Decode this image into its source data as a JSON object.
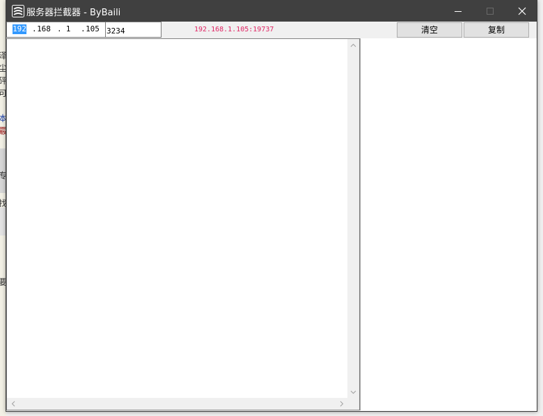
{
  "window": {
    "title": "服务器拦截器 - ByBaili",
    "app_icon": "stream-logo-icon",
    "controls": [
      "minimize-icon",
      "maximize-icon",
      "close-icon"
    ]
  },
  "toolbar": {
    "ip": {
      "seg1": "192",
      "seg2": "168",
      "seg3": "1",
      "seg4": "105"
    },
    "port": "3234",
    "status": "192.168.1.105:19737",
    "clear_label": "清空",
    "copy_label": "复制"
  },
  "background_app": {
    "fragments": [
      "泽",
      "尘",
      "砰",
      "可",
      "本",
      "霰",
      "专",
      "找",
      "要"
    ]
  },
  "colors": {
    "status": "#e02463",
    "titlebar": "#404040",
    "selection": "#3399ff"
  }
}
